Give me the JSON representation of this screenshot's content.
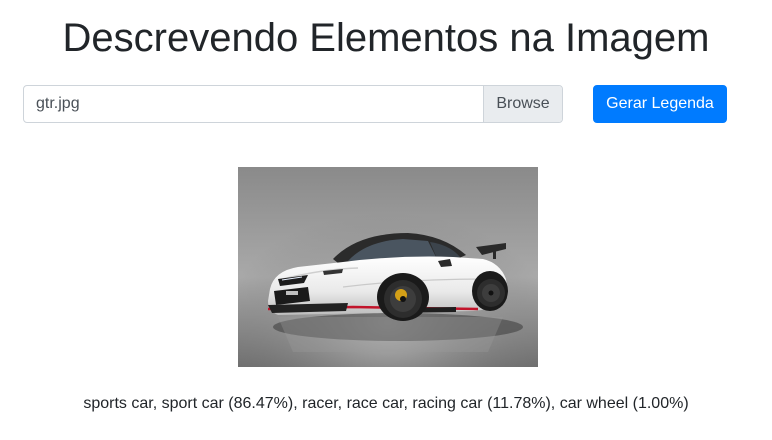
{
  "header": {
    "title": "Descrevendo Elementos na Imagem"
  },
  "upload": {
    "file_name": "gtr.jpg",
    "browse_label": "Browse",
    "submit_label": "Gerar Legenda"
  },
  "preview": {
    "image_subject": "white sports car"
  },
  "result": {
    "caption": "sports car, sport car (86.47%), racer, race car, racing car (11.78%), car wheel (1.00%)"
  },
  "colors": {
    "accent": "#007bff",
    "browse_bg": "#e9ecef",
    "border": "#ced4da"
  }
}
